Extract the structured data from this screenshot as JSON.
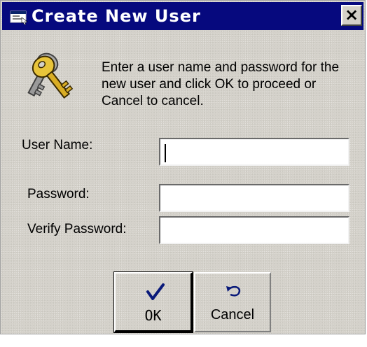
{
  "window": {
    "title": "Create New User",
    "close_label": "×"
  },
  "dialog": {
    "instructions": "Enter a user name and password for the new user and click OK to proceed or Cancel to cancel.",
    "icon": "keys-icon"
  },
  "form": {
    "user_name_label": "User Name:",
    "user_name_value": "",
    "password_label": "Password:",
    "password_value": "",
    "verify_password_label": "Verify Password:",
    "verify_password_value": ""
  },
  "buttons": {
    "ok_label": "OK",
    "ok_icon": "checkmark-icon",
    "cancel_label": "Cancel",
    "cancel_icon": "undo-arrow-icon"
  },
  "colors": {
    "titlebar": "#06097e",
    "window_bg": "#d3d0c9"
  }
}
